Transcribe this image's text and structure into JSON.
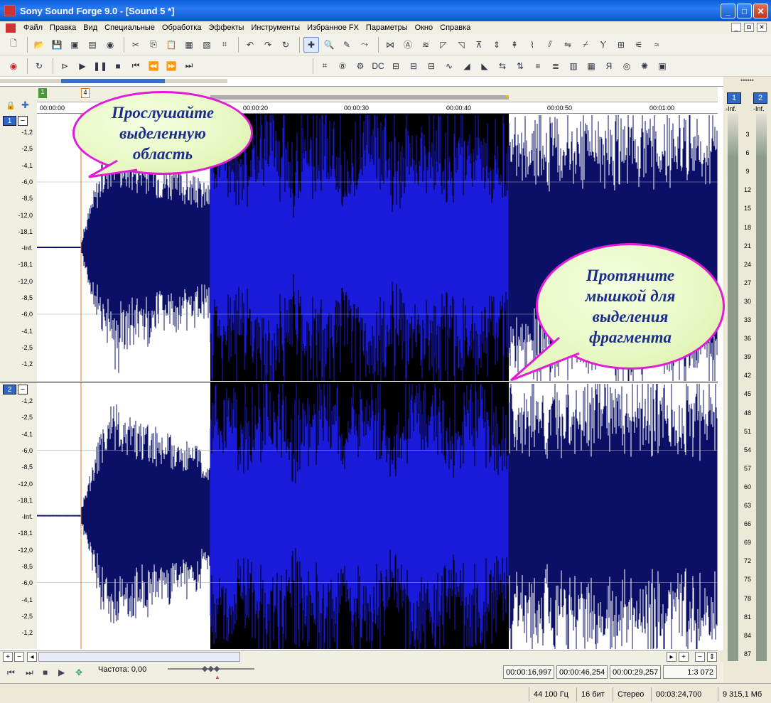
{
  "window": {
    "title": "Sony Sound Forge 9.0 - [Sound 5 *]",
    "buttons": [
      "_",
      "□",
      "✕"
    ]
  },
  "menu": [
    "Файл",
    "Правка",
    "Вид",
    "Специальные",
    "Обработка",
    "Эффекты",
    "Инструменты",
    "Избранное FX",
    "Параметры",
    "Окно",
    "Справка"
  ],
  "mdi_buttons": [
    "_",
    "⧉",
    "✕"
  ],
  "markers": {
    "m1": "1",
    "m2": "4"
  },
  "time_ruler": [
    "00:00:00",
    "00:00:20",
    "00:00:30",
    "00:00:40",
    "00:00:50",
    "00:01:00"
  ],
  "db_scale": [
    "-1,2",
    "-2,5",
    "-4,1",
    "-6,0",
    "-8,5",
    "-12,0",
    "-18,1",
    "-Inf.",
    "-18,1",
    "-12,0",
    "-8,5",
    "-6,0",
    "-4,1",
    "-2,5",
    "-1,2"
  ],
  "channels": [
    {
      "num": "1",
      "minus": "−"
    },
    {
      "num": "2",
      "minus": "−"
    }
  ],
  "transport": {
    "frequency_label": "Частота: 0,00"
  },
  "selection": {
    "start": "00:00:16,997",
    "end": "00:00:46,254",
    "length": "00:00:29,257",
    "zoom": "1:3 072"
  },
  "status": {
    "sample_rate": "44 100 Гц",
    "bit_depth": "16 бит",
    "channels": "Стерео",
    "duration": "00:03:24,700",
    "free_space": "9 315,1 Мб"
  },
  "meters": {
    "ch1": "1",
    "ch2": "2",
    "inf1": "-Inf.",
    "inf2": "-Inf.",
    "scale": [
      "3",
      "6",
      "9",
      "12",
      "15",
      "18",
      "21",
      "24",
      "27",
      "30",
      "33",
      "36",
      "39",
      "42",
      "45",
      "48",
      "51",
      "54",
      "57",
      "60",
      "63",
      "66",
      "69",
      "72",
      "75",
      "78",
      "81",
      "84",
      "87"
    ]
  },
  "callouts": {
    "top": [
      "Прослушайте",
      "выделенную",
      "область"
    ],
    "right": [
      "Протяните",
      "мышкой для",
      "выделения",
      "фрагмента"
    ]
  },
  "colors": {
    "waveform": "#0b1066",
    "selected_waveform": "#1a1adb",
    "selection_bg": "#000000",
    "callout_border": "#e21bd8",
    "callout_fill": "#e8f8c4",
    "callout_text": "#1a2d8a"
  }
}
